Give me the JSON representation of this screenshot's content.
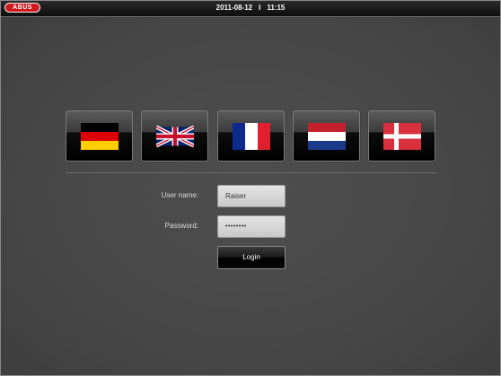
{
  "header": {
    "logo_text": "ABUS",
    "date": "2011-08-12",
    "separator": "I",
    "time": "11:15"
  },
  "languages": [
    {
      "name": "German",
      "icon": "flag-germany-icon"
    },
    {
      "name": "English",
      "icon": "flag-uk-icon"
    },
    {
      "name": "French",
      "icon": "flag-france-icon"
    },
    {
      "name": "Dutch",
      "icon": "flag-netherlands-icon"
    },
    {
      "name": "Danish",
      "icon": "flag-denmark-icon"
    }
  ],
  "login_form": {
    "username_label": "User name:",
    "username_value": "Raiser",
    "password_label": "Password:",
    "password_value": "••••••••",
    "login_button": "Login"
  },
  "colors": {
    "brand_red": "#d11a1f",
    "background": "#474747"
  }
}
